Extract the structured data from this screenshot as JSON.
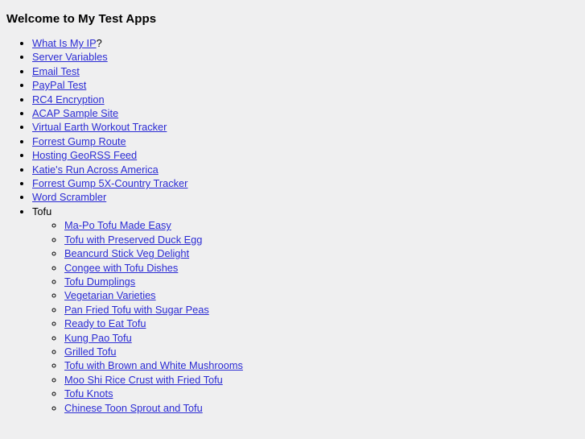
{
  "page": {
    "title": "Welcome to My Test Apps",
    "background_color": "#efeff0",
    "link_color": "#2b2bd4",
    "text_color": "#000000"
  },
  "list": {
    "marker_style": "disc",
    "items": [
      {
        "label": "What Is My IP",
        "is_link": true,
        "suffix": "?"
      },
      {
        "label": "Server Variables",
        "is_link": true,
        "suffix": ""
      },
      {
        "label": "Email Test",
        "is_link": true,
        "suffix": ""
      },
      {
        "label": "PayPal Test",
        "is_link": true,
        "suffix": ""
      },
      {
        "label": "RC4 Encryption",
        "is_link": true,
        "suffix": ""
      },
      {
        "label": "ACAP Sample Site",
        "is_link": true,
        "suffix": ""
      },
      {
        "label": "Virtual Earth Workout Tracker",
        "is_link": true,
        "suffix": ""
      },
      {
        "label": "Forrest Gump Route",
        "is_link": true,
        "suffix": ""
      },
      {
        "label": "Hosting GeoRSS Feed",
        "is_link": true,
        "suffix": ""
      },
      {
        "label": "Katie's Run Across America",
        "is_link": true,
        "suffix": ""
      },
      {
        "label": "Forrest Gump 5X-Country Tracker",
        "is_link": true,
        "suffix": ""
      },
      {
        "label": "Word Scrambler",
        "is_link": true,
        "suffix": ""
      },
      {
        "label": "Tofu",
        "is_link": false,
        "suffix": ""
      }
    ]
  },
  "sublist": {
    "marker_style": "circle",
    "parent": "Tofu",
    "items": [
      {
        "label": "Ma-Po Tofu Made Easy",
        "is_link": true
      },
      {
        "label": "Tofu with Preserved Duck Egg",
        "is_link": true
      },
      {
        "label": "Beancurd Stick Veg Delight",
        "is_link": true
      },
      {
        "label": "Congee with Tofu Dishes",
        "is_link": true
      },
      {
        "label": "Tofu Dumplings",
        "is_link": true
      },
      {
        "label": "Vegetarian Varieties",
        "is_link": true
      },
      {
        "label": "Pan Fried Tofu with Sugar Peas",
        "is_link": true
      },
      {
        "label": "Ready to Eat Tofu",
        "is_link": true
      },
      {
        "label": "Kung Pao Tofu",
        "is_link": true
      },
      {
        "label": "Grilled Tofu",
        "is_link": true
      },
      {
        "label": "Tofu with Brown and White Mushrooms",
        "is_link": true
      },
      {
        "label": "Moo Shi Rice Crust with Fried Tofu",
        "is_link": true
      },
      {
        "label": "Tofu Knots",
        "is_link": true
      },
      {
        "label": "Chinese Toon Sprout and Tofu",
        "is_link": true
      }
    ]
  }
}
